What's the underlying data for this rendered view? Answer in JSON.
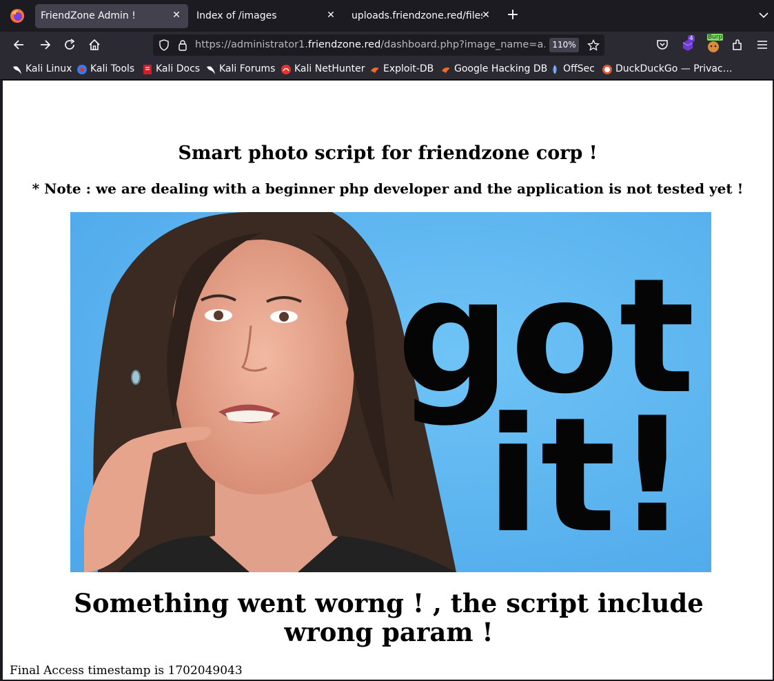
{
  "browser": {
    "tabs": [
      {
        "label": "FriendZone Admin !",
        "active": true
      },
      {
        "label": "Index of /images",
        "active": false
      },
      {
        "label": "uploads.friendzone.red/files/",
        "active": false
      }
    ],
    "url": {
      "prefix": "https://administrator1.",
      "host": "friendzone.red",
      "path": "/dashboard.php?image_name=a.jpg&"
    },
    "zoom": "110%",
    "extensions": [
      {
        "name": "pocket-icon"
      },
      {
        "name": "extension-badge-icon",
        "badge": "4"
      },
      {
        "name": "burp-icon",
        "badge": "Burp"
      },
      {
        "name": "extensions-icon"
      },
      {
        "name": "menu-icon"
      }
    ]
  },
  "bookmarks": [
    {
      "label": "Kali Linux",
      "icon": "kali-dragon-icon"
    },
    {
      "label": "Kali Tools",
      "icon": "kali-tools-icon"
    },
    {
      "label": "Kali Docs",
      "icon": "kali-docs-icon"
    },
    {
      "label": "Kali Forums",
      "icon": "kali-dragon-icon"
    },
    {
      "label": "Kali NetHunter",
      "icon": "nethunter-icon"
    },
    {
      "label": "Exploit-DB",
      "icon": "exploitdb-icon"
    },
    {
      "label": "Google Hacking DB",
      "icon": "exploitdb-icon"
    },
    {
      "label": "OffSec",
      "icon": "offsec-icon"
    },
    {
      "label": "DuckDuckGo — Privac…",
      "icon": "duckduckgo-icon"
    }
  ],
  "page": {
    "title": "Smart photo script for friendzone corp !",
    "note": "* Note : we are dealing with a beginner php developer and the application is not tested yet !",
    "image_text": {
      "line1": "got",
      "line2": "it!"
    },
    "error": "Something went worng ! , the script include wrong param !",
    "timestamp": "Final Access timestamp is 1702049043"
  },
  "colors": {
    "tabbar_bg": "#1c1b22",
    "toolbar_bg": "#2b2a33",
    "active_tab": "#42414d",
    "photo_bg": "#5cb8f2"
  }
}
